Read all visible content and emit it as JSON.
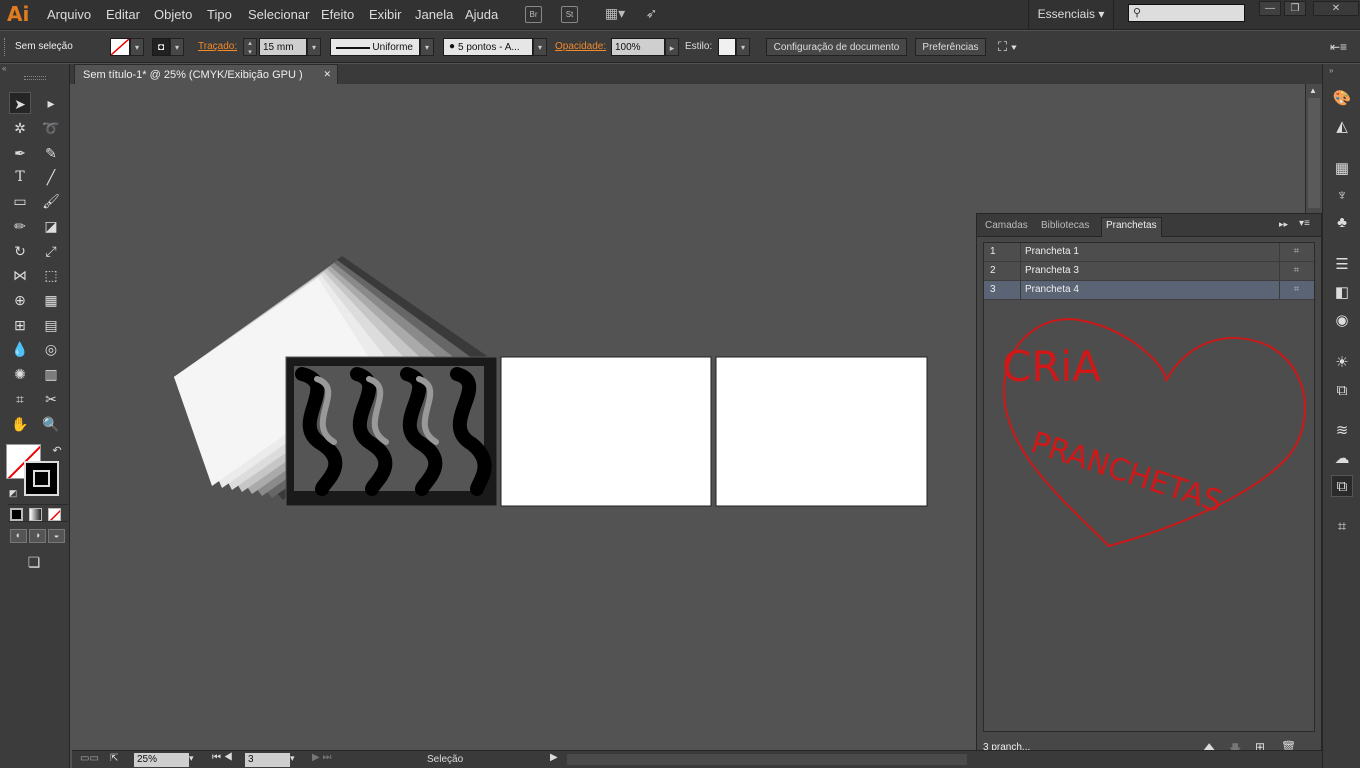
{
  "app": {
    "logo": "Ai",
    "menus": [
      "Arquivo",
      "Editar",
      "Objeto",
      "Tipo",
      "Selecionar",
      "Efeito",
      "Exibir",
      "Janela",
      "Ajuda"
    ],
    "bridge": "Br",
    "stock": "St",
    "workspace": "Essenciais"
  },
  "control": {
    "selection": "Sem seleção",
    "stroke_label": "Traçado:",
    "stroke_value": "15 mm",
    "profile": "Uniforme",
    "brush": "5 pontos - A...",
    "opacity_label": "Opacidade:",
    "opacity": "100%",
    "style_label": "Estilo:",
    "doc_setup": "Configuração de documento",
    "prefs": "Preferências"
  },
  "document": {
    "tab_title": "Sem título-1* @ 25% (CMYK/Exibição GPU )"
  },
  "status": {
    "zoom": "25%",
    "artboard_num": "3",
    "tool": "Seleção"
  },
  "panel": {
    "tabs": [
      "Camadas",
      "Bibliotecas",
      "Pranchetas"
    ],
    "active_tab": "Pranchetas",
    "rows": [
      {
        "num": "1",
        "name": "Prancheta 1"
      },
      {
        "num": "2",
        "name": "Prancheta 3"
      },
      {
        "num": "3",
        "name": "Prancheta 4"
      }
    ],
    "footer": "3 pranch..."
  },
  "annotation": {
    "line1": "CRiA",
    "line2": "PRANCHETAS"
  },
  "colors": {
    "accent_orange": "#e07c1f",
    "annotation_red": "#d01818",
    "selected_row": "#5a6475"
  }
}
